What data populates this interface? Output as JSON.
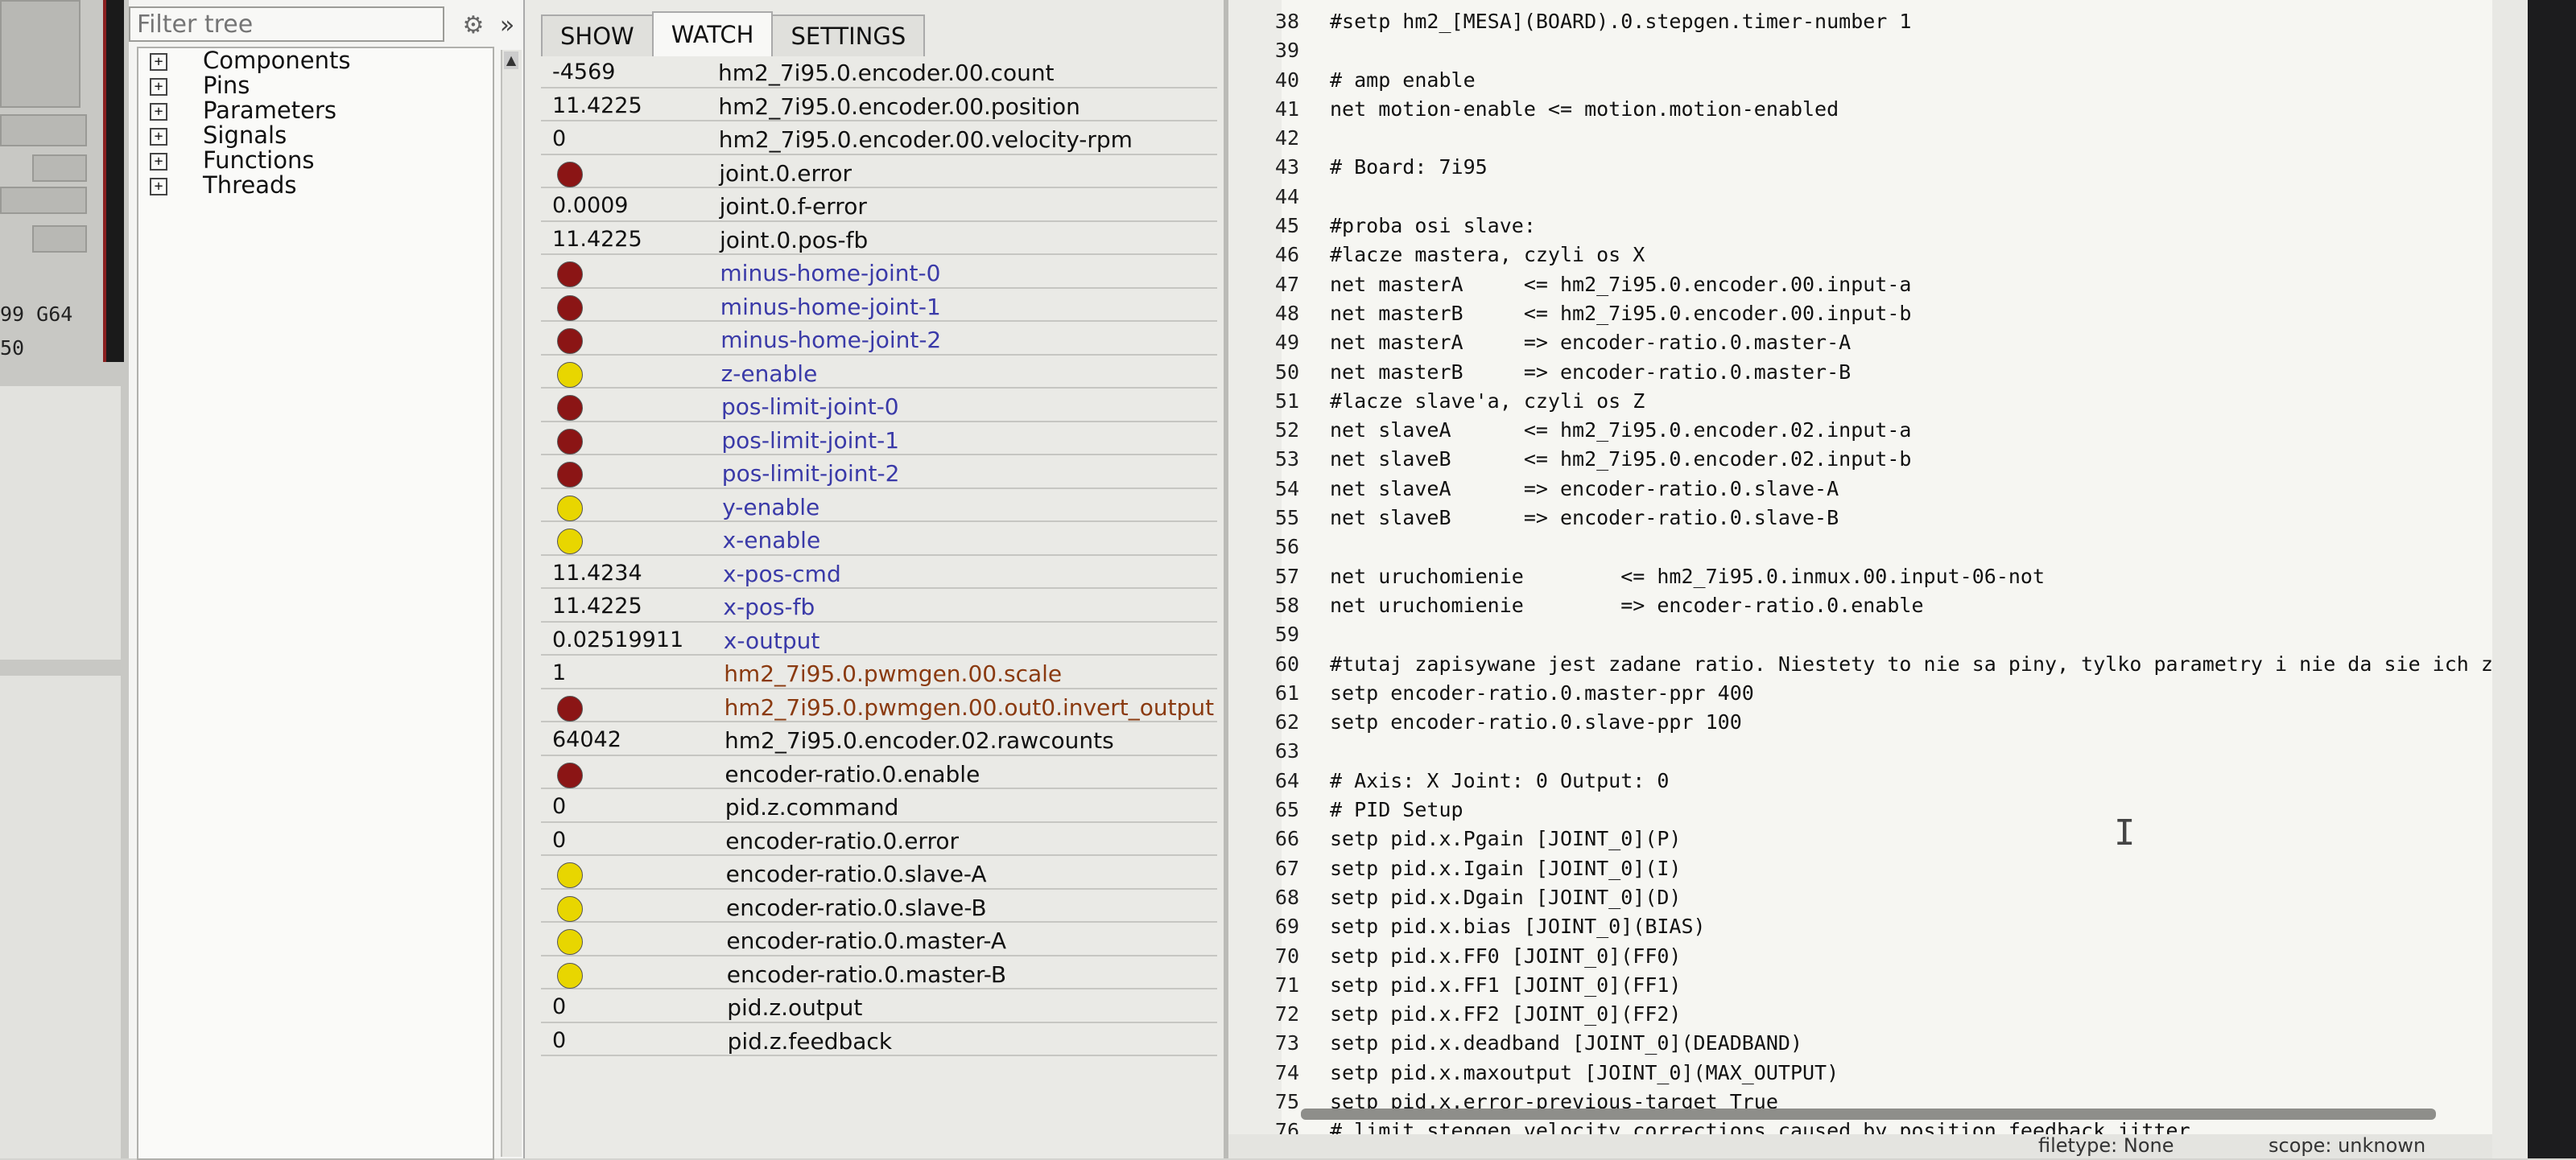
{
  "left": {
    "gcode_lines": [
      "99 G64",
      "50"
    ]
  },
  "tree": {
    "filter_placeholder": "Filter tree",
    "gear_icon": "gear-icon",
    "chevron_icon": "double-chevron-right-icon",
    "items": [
      {
        "label": "Components"
      },
      {
        "label": "Pins"
      },
      {
        "label": "Parameters"
      },
      {
        "label": "Signals"
      },
      {
        "label": "Functions"
      },
      {
        "label": "Threads"
      }
    ],
    "expander_symbol": "⊞"
  },
  "watch": {
    "tabs": [
      "SHOW",
      "WATCH",
      "SETTINGS"
    ],
    "active_tab": "WATCH",
    "led_colors": {
      "red": "#8b1515",
      "yellow": "#e8d600"
    },
    "rows": [
      {
        "value": "-4569",
        "name": "hm2_7i95.0.encoder.00.count",
        "color": "black"
      },
      {
        "value": "11.4225",
        "name": "hm2_7i95.0.encoder.00.position",
        "color": "black"
      },
      {
        "value": "0",
        "name": "hm2_7i95.0.encoder.00.velocity-rpm",
        "color": "black"
      },
      {
        "led": "red",
        "name": "joint.0.error",
        "color": "black"
      },
      {
        "value": "0.0009",
        "name": "joint.0.f-error",
        "color": "black"
      },
      {
        "value": "11.4225",
        "name": "joint.0.pos-fb",
        "color": "black"
      },
      {
        "led": "red",
        "name": "minus-home-joint-0",
        "color": "blue"
      },
      {
        "led": "red",
        "name": "minus-home-joint-1",
        "color": "blue"
      },
      {
        "led": "red",
        "name": "minus-home-joint-2",
        "color": "blue"
      },
      {
        "led": "yellow",
        "name": "z-enable",
        "color": "blue"
      },
      {
        "led": "red",
        "name": "pos-limit-joint-0",
        "color": "blue"
      },
      {
        "led": "red",
        "name": "pos-limit-joint-1",
        "color": "blue"
      },
      {
        "led": "red",
        "name": "pos-limit-joint-2",
        "color": "blue"
      },
      {
        "led": "yellow",
        "name": "y-enable",
        "color": "blue"
      },
      {
        "led": "yellow",
        "name": "x-enable",
        "color": "blue"
      },
      {
        "value": "11.4234",
        "name": "x-pos-cmd",
        "color": "blue"
      },
      {
        "value": "11.4225",
        "name": "x-pos-fb",
        "color": "blue"
      },
      {
        "value": "0.02519911",
        "name": "x-output",
        "color": "blue"
      },
      {
        "value": "1",
        "name": "hm2_7i95.0.pwmgen.00.scale",
        "color": "red"
      },
      {
        "led": "red",
        "name": "hm2_7i95.0.pwmgen.00.out0.invert_output",
        "color": "red"
      },
      {
        "value": "64042",
        "name": "hm2_7i95.0.encoder.02.rawcounts",
        "color": "black"
      },
      {
        "led": "red",
        "name": "encoder-ratio.0.enable",
        "color": "black"
      },
      {
        "value": "0",
        "name": "pid.z.command",
        "color": "black"
      },
      {
        "value": "0",
        "name": "encoder-ratio.0.error",
        "color": "black"
      },
      {
        "led": "yellow",
        "name": "encoder-ratio.0.slave-A",
        "color": "black"
      },
      {
        "led": "yellow",
        "name": "encoder-ratio.0.slave-B",
        "color": "black"
      },
      {
        "led": "yellow",
        "name": "encoder-ratio.0.master-A",
        "color": "black"
      },
      {
        "led": "yellow",
        "name": "encoder-ratio.0.master-B",
        "color": "black"
      },
      {
        "value": "0",
        "name": "pid.z.output",
        "color": "black"
      },
      {
        "value": "0",
        "name": "pid.z.feedback",
        "color": "black"
      }
    ]
  },
  "editor": {
    "lines": [
      {
        "n": "38",
        "t": "#setp hm2_[MESA](BOARD).0.stepgen.timer-number 1"
      },
      {
        "n": "39",
        "t": ""
      },
      {
        "n": "40",
        "t": "# amp enable"
      },
      {
        "n": "41",
        "t": "net motion-enable <= motion.motion-enabled"
      },
      {
        "n": "42",
        "t": ""
      },
      {
        "n": "43",
        "t": "# Board: 7i95"
      },
      {
        "n": "44",
        "t": ""
      },
      {
        "n": "45",
        "t": "#proba osi slave:"
      },
      {
        "n": "46",
        "t": "#lacze mastera, czyli os X"
      },
      {
        "n": "47",
        "t": "net masterA     <= hm2_7i95.0.encoder.00.input-a"
      },
      {
        "n": "48",
        "t": "net masterB     <= hm2_7i95.0.encoder.00.input-b"
      },
      {
        "n": "49",
        "t": "net masterA     => encoder-ratio.0.master-A"
      },
      {
        "n": "50",
        "t": "net masterB     => encoder-ratio.0.master-B"
      },
      {
        "n": "51",
        "t": "#lacze slave'a, czyli os Z"
      },
      {
        "n": "52",
        "t": "net slaveA      <= hm2_7i95.0.encoder.02.input-a"
      },
      {
        "n": "53",
        "t": "net slaveB      <= hm2_7i95.0.encoder.02.input-b"
      },
      {
        "n": "54",
        "t": "net slaveA      => encoder-ratio.0.slave-A"
      },
      {
        "n": "55",
        "t": "net slaveB      => encoder-ratio.0.slave-B"
      },
      {
        "n": "56",
        "t": ""
      },
      {
        "n": "57",
        "t": "net uruchomienie        <= hm2_7i95.0.inmux.00.input-06-not"
      },
      {
        "n": "58",
        "t": "net uruchomienie        => encoder-ratio.0.enable"
      },
      {
        "n": "59",
        "t": ""
      },
      {
        "n": "60",
        "t": "#tutaj zapisywane jest zadane ratio. Niestety to nie sa piny, tylko parametry i nie da sie ich zmieniac o"
      },
      {
        "n": "61",
        "t": "setp encoder-ratio.0.master-ppr 400"
      },
      {
        "n": "62",
        "t": "setp encoder-ratio.0.slave-ppr 100"
      },
      {
        "n": "63",
        "t": ""
      },
      {
        "n": "64",
        "t": "# Axis: X Joint: 0 Output: 0"
      },
      {
        "n": "65",
        "t": "# PID Setup"
      },
      {
        "n": "66",
        "t": "setp pid.x.Pgain [JOINT_0](P)"
      },
      {
        "n": "67",
        "t": "setp pid.x.Igain [JOINT_0](I)"
      },
      {
        "n": "68",
        "t": "setp pid.x.Dgain [JOINT_0](D)"
      },
      {
        "n": "69",
        "t": "setp pid.x.bias [JOINT_0](BIAS)"
      },
      {
        "n": "70",
        "t": "setp pid.x.FF0 [JOINT_0](FF0)"
      },
      {
        "n": "71",
        "t": "setp pid.x.FF1 [JOINT_0](FF1)"
      },
      {
        "n": "72",
        "t": "setp pid.x.FF2 [JOINT_0](FF2)"
      },
      {
        "n": "73",
        "t": "setp pid.x.deadband [JOINT_0](DEADBAND)"
      },
      {
        "n": "74",
        "t": "setp pid.x.maxoutput [JOINT_0](MAX_OUTPUT)"
      },
      {
        "n": "75",
        "t": "setp pid.x.error-previous-target True"
      },
      {
        "n": "76",
        "t": "# limit stepgen velocity corrections caused by position feedback jitter"
      }
    ],
    "cursor_glyph": "I"
  },
  "status": {
    "filetype": "filetype: None",
    "scope": "scope: unknown"
  }
}
